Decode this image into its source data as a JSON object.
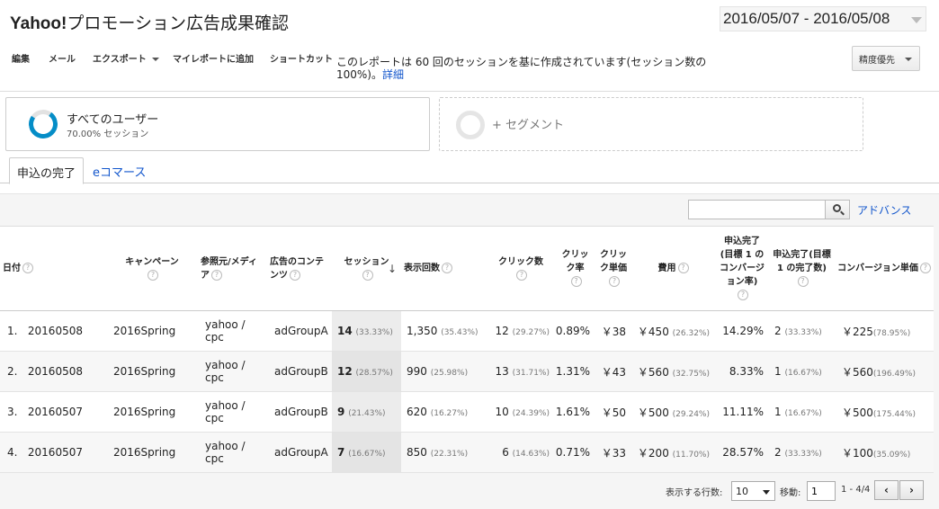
{
  "header": {
    "title_brand": "Yahoo!",
    "title_rest": "プロモーション広告成果確認",
    "date_range": "2016/05/07 - 2016/05/08"
  },
  "toolbar": {
    "edit": "編集",
    "mail": "メール",
    "export": "エクスポート",
    "add_myreport": "マイレポートに追加",
    "shortcut": "ショートカット",
    "report_note": "このレポートは 60 回のセッションを基に作成されています(セッション数の 100%)。",
    "detail_link": "詳細",
    "accuracy": "精度優先"
  },
  "segments": {
    "active_name": "すべてのユーザー",
    "active_sub": "70.00% セッション",
    "add_label": "+ セグメント"
  },
  "tabs": {
    "active": "申込の完了",
    "other": "eコマース"
  },
  "search": {
    "placeholder": "",
    "advance": "アドバンス"
  },
  "table": {
    "headers": {
      "date": "日付",
      "campaign": "キャンペーン",
      "source": "参照元/メディア",
      "content": "広告のコンテンツ",
      "sessions": "セッション",
      "impressions": "表示回数",
      "clicks": "クリック数",
      "ctr": "クリック率",
      "cpc": "クリック単価",
      "cost": "費用",
      "goal_rate": "申込完了(目標 1 のコンバージョン率)",
      "goal_count": "申込完了(目標 1 の完了数)",
      "cpa": "コンバージョン単価"
    },
    "rows": [
      {
        "idx": "1.",
        "date": "20160508",
        "campaign": "2016Spring",
        "source": "yahoo / cpc",
        "content": "adGroupA",
        "sessions": "14",
        "sessions_pct": "(33.33%)",
        "impressions": "1,350",
        "impressions_pct": "(35.43%)",
        "clicks": "12",
        "clicks_pct": "(29.27%)",
        "ctr": "0.89%",
        "cpc": "￥38",
        "cost": "￥450",
        "cost_pct": "(26.32%)",
        "goal_rate": "14.29%",
        "goal_count": "2",
        "goal_count_pct": "(33.33%)",
        "cpa": "￥225",
        "cpa_pct": "(78.95%)"
      },
      {
        "idx": "2.",
        "date": "20160508",
        "campaign": "2016Spring",
        "source": "yahoo / cpc",
        "content": "adGroupB",
        "sessions": "12",
        "sessions_pct": "(28.57%)",
        "impressions": "990",
        "impressions_pct": "(25.98%)",
        "clicks": "13",
        "clicks_pct": "(31.71%)",
        "ctr": "1.31%",
        "cpc": "￥43",
        "cost": "￥560",
        "cost_pct": "(32.75%)",
        "goal_rate": "8.33%",
        "goal_count": "1",
        "goal_count_pct": "(16.67%)",
        "cpa": "￥560",
        "cpa_pct": "(196.49%)"
      },
      {
        "idx": "3.",
        "date": "20160507",
        "campaign": "2016Spring",
        "source": "yahoo / cpc",
        "content": "adGroupB",
        "sessions": "9",
        "sessions_pct": "(21.43%)",
        "impressions": "620",
        "impressions_pct": "(16.27%)",
        "clicks": "10",
        "clicks_pct": "(24.39%)",
        "ctr": "1.61%",
        "cpc": "￥50",
        "cost": "￥500",
        "cost_pct": "(29.24%)",
        "goal_rate": "11.11%",
        "goal_count": "1",
        "goal_count_pct": "(16.67%)",
        "cpa": "￥500",
        "cpa_pct": "(175.44%)"
      },
      {
        "idx": "4.",
        "date": "20160507",
        "campaign": "2016Spring",
        "source": "yahoo / cpc",
        "content": "adGroupA",
        "sessions": "7",
        "sessions_pct": "(16.67%)",
        "impressions": "850",
        "impressions_pct": "(22.31%)",
        "clicks": "6",
        "clicks_pct": "(14.63%)",
        "ctr": "0.71%",
        "cpc": "￥33",
        "cost": "￥200",
        "cost_pct": "(11.70%)",
        "goal_rate": "28.57%",
        "goal_count": "2",
        "goal_count_pct": "(33.33%)",
        "cpa": "￥100",
        "cpa_pct": "(35.09%)"
      }
    ]
  },
  "pager": {
    "rows_label": "表示する行数:",
    "rows_value": "10",
    "goto_label": "移動:",
    "goto_value": "1",
    "range": "1 - 4/4",
    "prev": "‹",
    "next": "›"
  }
}
